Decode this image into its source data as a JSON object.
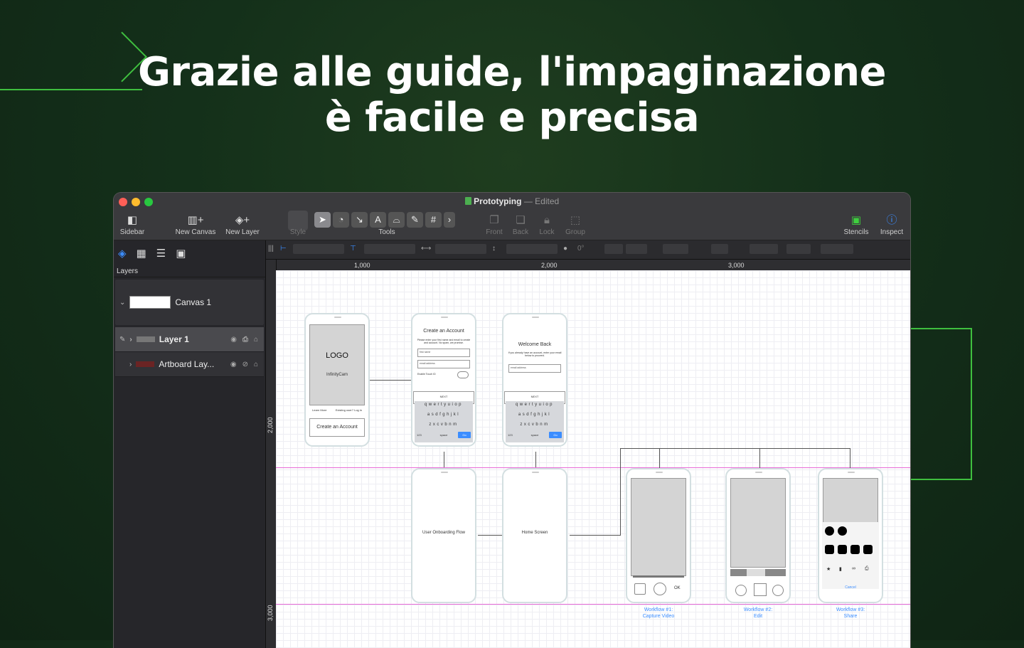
{
  "headline": {
    "line1": "Grazie alle guide, l'impaginazione",
    "line2": "è facile e precisa"
  },
  "window": {
    "title": "Prototyping",
    "separator": "—",
    "status": "Edited"
  },
  "toolbar": {
    "sidebar": "Sidebar",
    "new_canvas": "New Canvas",
    "new_layer": "New Layer",
    "style": "Style",
    "tools": "Tools",
    "front": "Front",
    "back": "Back",
    "lock": "Lock",
    "group": "Group",
    "stencils": "Stencils",
    "inspect": "Inspect"
  },
  "sidebar": {
    "section_label": "Layers",
    "canvas_name": "Canvas 1",
    "layers": [
      {
        "name": "Layer 1"
      },
      {
        "name": "Artboard Lay..."
      }
    ]
  },
  "inspector_bar": {
    "rotation": "0°"
  },
  "rulers": {
    "h_labels": [
      "1,000",
      "2,000",
      "3,000"
    ],
    "v_labels": [
      "2,000",
      "3,000"
    ]
  },
  "canvas": {
    "screen1": {
      "logo": "LOGO",
      "app": "InfinityCam",
      "learn_more": "Learn More",
      "existing": "Existing user? Log in",
      "cta": "Create an Account"
    },
    "screen2": {
      "title": "Create an Account",
      "subtitle": "Please enter your first name and email to create and account. No spam, we promise.",
      "field1": "first name",
      "field2": "email address",
      "toggle_label": "Enable Touch ID",
      "button": "NEXT"
    },
    "screen3": {
      "title": "Welcome Back",
      "subtitle": "If you already have an account, enter your email below to proceed.",
      "field1": "email address",
      "button": "NEXT"
    },
    "keyboard": {
      "row1": "qwertyuiop",
      "row2": "asdfghjkl",
      "row3": "zxcvbnm",
      "space": "space",
      "go": "Go",
      "num": "123"
    },
    "screen4": {
      "label": "User Onboarding Flow"
    },
    "screen5": {
      "label": "Home Screen"
    },
    "workflow1": {
      "line1": "Workflow #1:",
      "line2": "Capture Video",
      "ok": "OK"
    },
    "workflow2": {
      "line1": "Workflow #2:",
      "line2": "Edit"
    },
    "workflow3": {
      "line1": "Workflow #3:",
      "line2": "Share",
      "cancel": "Cancel"
    }
  },
  "colors": {
    "accent_green": "#3fbf3f",
    "guide_magenta": "#e86bd8",
    "link_blue": "#3b8dff"
  }
}
